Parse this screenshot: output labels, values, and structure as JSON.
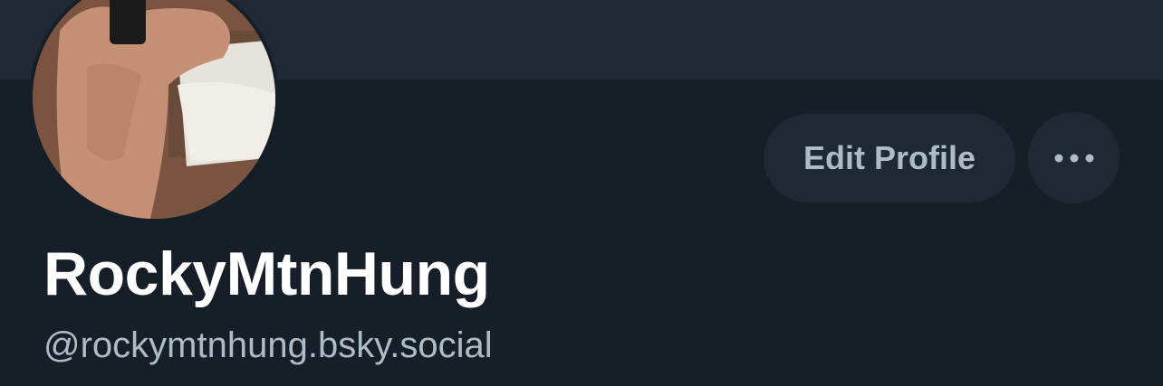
{
  "profile": {
    "display_name": "RockyMtnHung",
    "handle": "@rockymtnhung.bsky.social"
  },
  "actions": {
    "edit_label": "Edit Profile",
    "more_icon": "ellipsis-icon"
  },
  "colors": {
    "background": "#161e27",
    "banner": "#1e2935",
    "button_bg": "#1e2935",
    "button_text": "#aebbc9",
    "name_text": "#ffffff",
    "handle_text": "#aebbc9"
  }
}
